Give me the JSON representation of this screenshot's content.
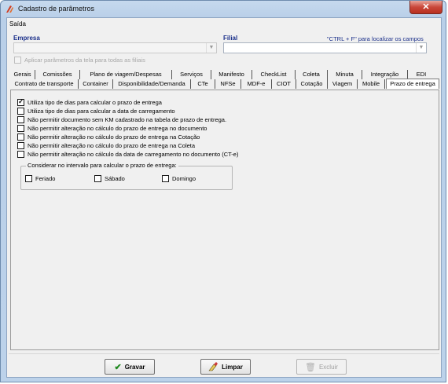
{
  "window": {
    "title": "Cadastro de parâmetros",
    "close_glyph": "✕"
  },
  "menu": {
    "items": [
      {
        "label": "Saída"
      }
    ]
  },
  "filters": {
    "empresa_label": "Empresa",
    "filial_label": "Filial",
    "empresa_value": "",
    "filial_value": "",
    "shortcut_hint": "\"CTRL + F\" para localizar os campos",
    "apply_all_label": "Aplicar parâmetros da tela para todas as filiais"
  },
  "tabs_row1": [
    "Gerais",
    "Comissões",
    "Plano de viagem/Despesas",
    "Serviços",
    "Manifesto",
    "CheckList",
    "Coleta",
    "Minuta",
    "Integração",
    "EDI"
  ],
  "tabs_row2": [
    "Contrato de transporte",
    "Container",
    "Disponibilidade/Demanda",
    "CTe",
    "NFSe",
    "MDF-e",
    "CIOT",
    "Cotação",
    "Viagem",
    "Mobile",
    "Prazo de entrega"
  ],
  "active_tab": "Prazo de entrega",
  "options": [
    {
      "label": "Utiliza tipo de dias para calcular o prazo de entrega",
      "checked": true
    },
    {
      "label": "Utiliza tipo de dias para calcular a data de carregamento",
      "checked": false
    },
    {
      "label": "Não permitir documento sem KM cadastrado na tabela de prazo de entrega.",
      "checked": false
    },
    {
      "label": "Não permitir alteração no cálculo do prazo de entrega no documento",
      "checked": false
    },
    {
      "label": "Não permitir alteração no cálculo do prazo de entrega na Cotação",
      "checked": false
    },
    {
      "label": "Não permitir alteração no cálculo do prazo de entrega na Coleta",
      "checked": false
    },
    {
      "label": "Não permitir alteração no cálculo da data de carregamento no documento (CT-e)",
      "checked": false
    }
  ],
  "interval_group": {
    "legend": "Considerar no intervalo para calcular o prazo de entrega:",
    "items": [
      {
        "label": "Feriado",
        "checked": false
      },
      {
        "label": "Sábado",
        "checked": false
      },
      {
        "label": "Domingo",
        "checked": false
      }
    ]
  },
  "buttons": {
    "save": "Gravar",
    "clear": "Limpar",
    "delete": "Excluir"
  },
  "icons": {
    "app": "app-logo-icon",
    "save": "checkmark-icon",
    "clear": "eraser-icon",
    "delete": "trash-icon",
    "dropdown": "chevron-down-icon"
  },
  "colors": {
    "label_blue": "#1a2f8a",
    "title_bar": "#b9cfe8",
    "close_red": "#c9473a"
  }
}
